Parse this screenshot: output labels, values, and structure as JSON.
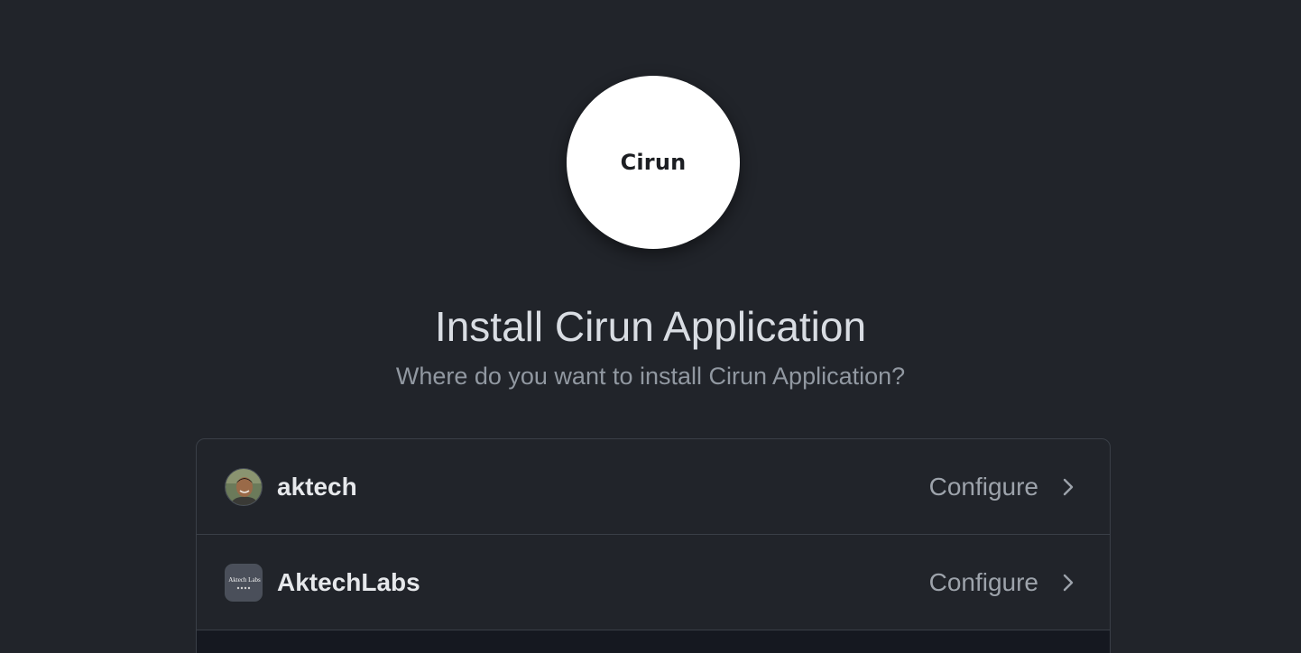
{
  "app": {
    "logo_text": "Cirun",
    "title": "Install Cirun Application",
    "subtitle": "Where do you want to install Cirun Application?"
  },
  "accounts": [
    {
      "name": "aktech",
      "action": "Configure",
      "avatar": "user-avatar"
    },
    {
      "name": "AktechLabs",
      "action": "Configure",
      "avatar": "org-avatar",
      "avatar_text": "Aktech Labs"
    }
  ],
  "colors": {
    "background": "#21242a",
    "border": "#3a3f47",
    "footer": "#151820",
    "text_primary": "#e6e8eb",
    "text_secondary": "#9da3ab"
  }
}
